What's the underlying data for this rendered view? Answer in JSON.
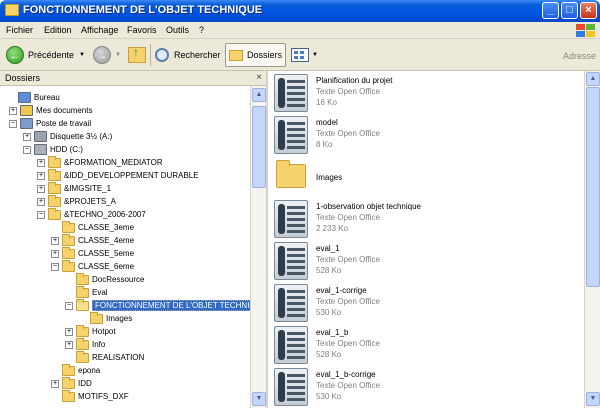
{
  "window": {
    "title": "FONCTIONNEMENT DE L'OBJET TECHNIQUE"
  },
  "menu": [
    "Fichier",
    "Edition",
    "Affichage",
    "Favoris",
    "Outils",
    "?"
  ],
  "toolbar": {
    "back_label": "Précédente",
    "search_label": "Rechercher",
    "folders_label": "Dossiers",
    "address_label": "Adresse"
  },
  "folders_pane": {
    "header": "Dossiers",
    "close_symbol": "×",
    "items": [
      {
        "label": "Bureau",
        "expander": "",
        "icon": "desktop-icon"
      },
      {
        "label": "Mes documents",
        "expander": "+",
        "icon": "my-documents-icon"
      },
      {
        "label": "Poste de travail",
        "expander": "−",
        "icon": "my-computer-icon"
      },
      {
        "label": "Disquette 3½ (A:)",
        "expander": "+",
        "icon": "floppy-drive-icon"
      },
      {
        "label": "HDD (C:)",
        "expander": "−",
        "icon": "hard-drive-icon"
      },
      {
        "label": "&FORMATION_MEDIATOR",
        "expander": "+",
        "icon": "folder-icon"
      },
      {
        "label": "&IDD_DEVELOPPEMENT DURABLE",
        "expander": "+",
        "icon": "folder-icon"
      },
      {
        "label": "&IMGSITE_1",
        "expander": "+",
        "icon": "folder-icon"
      },
      {
        "label": "&PROJETS_A",
        "expander": "+",
        "icon": "folder-icon"
      },
      {
        "label": "&TECHNO_2006-2007",
        "expander": "−",
        "icon": "folder-icon"
      },
      {
        "label": "CLASSE_3eme",
        "expander": "",
        "icon": "folder-icon"
      },
      {
        "label": "CLASSE_4eme",
        "expander": "+",
        "icon": "folder-icon"
      },
      {
        "label": "CLASSE_5eme",
        "expander": "+",
        "icon": "folder-icon"
      },
      {
        "label": "CLASSE_6eme",
        "expander": "−",
        "icon": "folder-icon"
      },
      {
        "label": "DocRessource",
        "expander": "",
        "icon": "folder-icon"
      },
      {
        "label": "Eval",
        "expander": "",
        "icon": "folder-icon"
      },
      {
        "label": "FONCTIONNEMENT DE L'OBJET TECHNIQUE",
        "expander": "−",
        "icon": "open-folder-icon",
        "selected": true
      },
      {
        "label": "Images",
        "expander": "",
        "icon": "folder-icon"
      },
      {
        "label": "Hotpot",
        "expander": "+",
        "icon": "folder-icon"
      },
      {
        "label": "Info",
        "expander": "+",
        "icon": "folder-icon"
      },
      {
        "label": "REALISATION",
        "expander": "",
        "icon": "folder-icon"
      },
      {
        "label": "epona",
        "expander": "",
        "icon": "folder-icon"
      },
      {
        "label": "IDD",
        "expander": "+",
        "icon": "folder-icon"
      },
      {
        "label": "MOTIFS_DXF",
        "expander": "",
        "icon": "folder-icon"
      }
    ]
  },
  "files": [
    {
      "name": "Planification du projet",
      "type": "Texte Open Office",
      "size": "16 Ko",
      "icon": "odt-document-icon"
    },
    {
      "name": "model",
      "type": "Texte Open Office",
      "size": "8 Ko",
      "icon": "odt-document-icon"
    },
    {
      "name": "Images",
      "type": "",
      "size": "",
      "icon": "folder-icon"
    },
    {
      "name": "1-observation objet technique",
      "type": "Texte Open Office",
      "size": "2 233 Ko",
      "icon": "odt-document-icon"
    },
    {
      "name": "eval_1",
      "type": "Texte Open Office",
      "size": "528 Ko",
      "icon": "odt-document-icon"
    },
    {
      "name": "eval_1-corrige",
      "type": "Texte Open Office",
      "size": "530 Ko",
      "icon": "odt-document-icon"
    },
    {
      "name": "eval_1_b",
      "type": "Texte Open Office",
      "size": "528 Ko",
      "icon": "odt-document-icon"
    },
    {
      "name": "eval_1_b-corrige",
      "type": "Texte Open Office",
      "size": "530 Ko",
      "icon": "odt-document-icon"
    }
  ]
}
